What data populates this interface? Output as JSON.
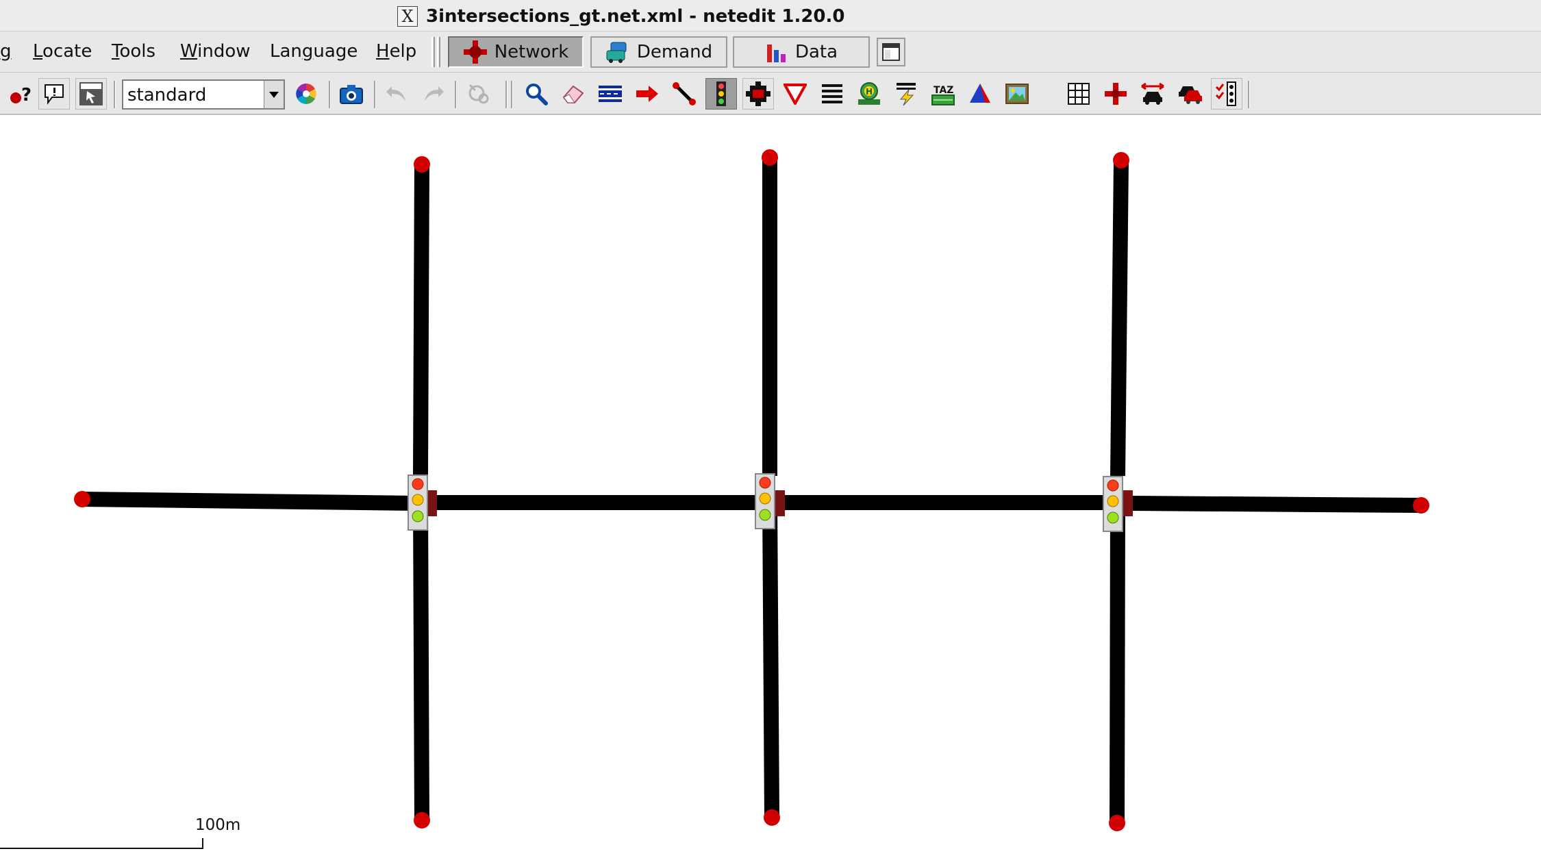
{
  "window": {
    "title": "3intersections_gt.net.xml - netedit 1.20.0",
    "x_glyph": "X"
  },
  "menu": {
    "items": [
      {
        "pre": "",
        "mn": "g",
        "post": ""
      },
      {
        "pre": "",
        "mn": "L",
        "post": "ocate"
      },
      {
        "pre": "",
        "mn": "T",
        "post": "ools"
      },
      {
        "pre": "",
        "mn": "W",
        "post": "indow"
      },
      {
        "pre": "Lan",
        "mn": "g",
        "post": "uage"
      },
      {
        "pre": "",
        "mn": "H",
        "post": "elp"
      }
    ]
  },
  "modes": {
    "network": "Network",
    "demand": "Demand",
    "data": "Data",
    "active": "network"
  },
  "toolbar": {
    "scheme": "standard"
  },
  "canvas": {
    "scale_label": "100m",
    "colors": {
      "road": "#000000",
      "endpoint": "#d20000",
      "junction": "#7a1414"
    }
  }
}
